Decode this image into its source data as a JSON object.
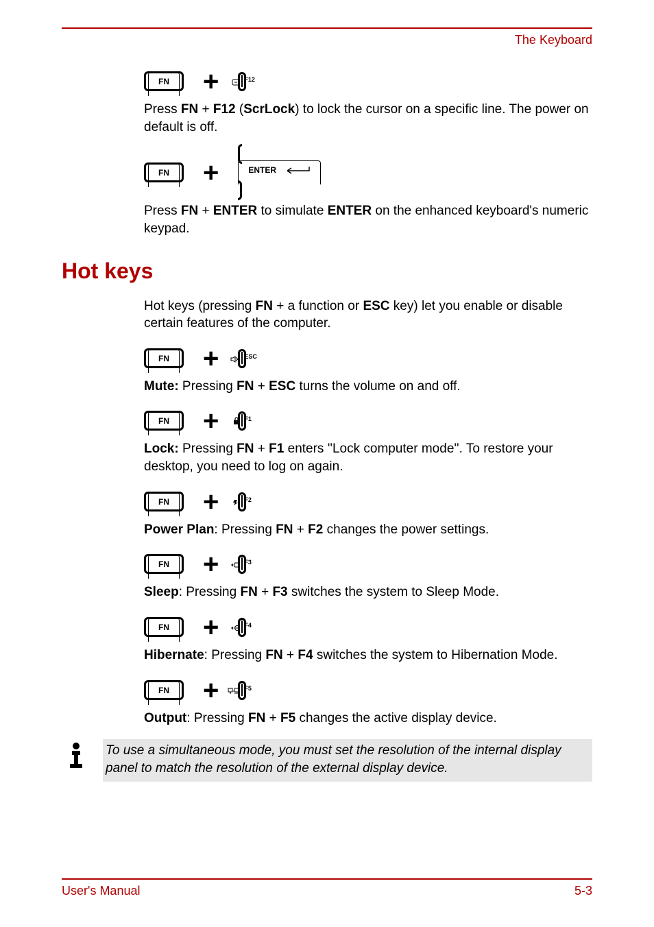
{
  "header": {
    "right": "The Keyboard"
  },
  "rows": [
    {
      "key2_label": "F12",
      "icon": "scrlock"
    },
    {
      "key2_label": "ENTER",
      "icon": "enter"
    }
  ],
  "para_f12_1": "Press ",
  "para_f12_2": "FN",
  "para_f12_3": " + ",
  "para_f12_4": "F12",
  "para_f12_5": " (",
  "para_f12_6": "ScrLock",
  "para_f12_7": ") to lock the cursor on a specific line. The power on default is off.",
  "para_enter_1": "Press ",
  "para_enter_2": "FN",
  "para_enter_3": " + ",
  "para_enter_4": "ENTER",
  "para_enter_5": " to simulate ",
  "para_enter_6": "ENTER",
  "para_enter_7": " on the enhanced keyboard's numeric keypad.",
  "section": {
    "title": "Hot keys"
  },
  "intro_1": "Hot keys (pressing ",
  "intro_2": "FN",
  "intro_3": " + a function or ",
  "intro_4": "ESC",
  "intro_5": " key) let you enable or disable certain features of the computer.",
  "hot": [
    {
      "k": "ESC",
      "name": "Mute:",
      "lead": " Pressing ",
      "b1": "FN",
      "mid": " + ",
      "b2": "ESC",
      "tail": " turns the volume on and off.",
      "icon": "mute"
    },
    {
      "k": "F1",
      "name": "Lock:",
      "lead": " Pressing ",
      "b1": "FN",
      "mid": " + ",
      "b2": "F1",
      "tail": " enters ''Lock computer mode''. To restore your desktop, you need to log on again.",
      "icon": "lock"
    },
    {
      "k": "F2",
      "name": "Power Plan",
      "lead": ": Pressing ",
      "b1": "FN",
      "mid": " + ",
      "b2": "F2",
      "tail": " changes the power settings.",
      "icon": "power"
    },
    {
      "k": "F3",
      "name": "Sleep",
      "lead": ": Pressing ",
      "b1": "FN",
      "mid": " + ",
      "b2": "F3",
      "tail": " switches the system to Sleep Mode.",
      "icon": "sleep"
    },
    {
      "k": "F4",
      "name": "Hibernate",
      "lead": ": Pressing ",
      "b1": "FN",
      "mid": " + ",
      "b2": "F4",
      "tail": " switches the system to Hibernation Mode.",
      "icon": "hibernate"
    },
    {
      "k": "F5",
      "name": "Output",
      "lead": ": Pressing ",
      "b1": "FN",
      "mid": " + ",
      "b2": "F5",
      "tail": " changes the active display device.",
      "icon": "output"
    }
  ],
  "note": "To use a simultaneous mode, you must set the resolution of the internal display panel to match the resolution of the external display device.",
  "fn_label": "FN",
  "plus": "+",
  "footer": {
    "left": "User's Manual",
    "right": "5-3"
  }
}
